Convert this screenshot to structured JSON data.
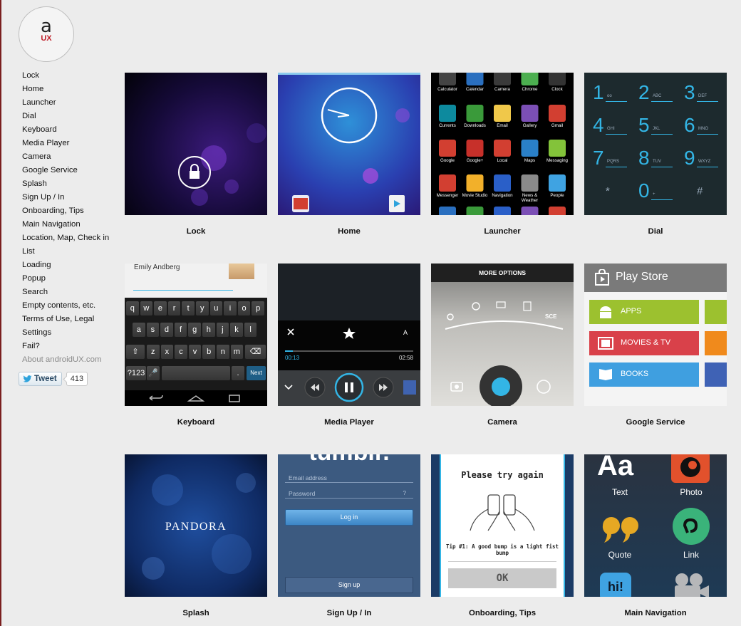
{
  "logo": {
    "letter": "a",
    "sub": "UX"
  },
  "nav": [
    "Lock",
    "Home",
    "Launcher",
    "Dial",
    "Keyboard",
    "Media Player",
    "Camera",
    "Google Service",
    "Splash",
    "Sign Up / In",
    "Onboarding, Tips",
    "Main Navigation",
    "Location, Map, Check in",
    "List",
    "Loading",
    "Popup",
    "Search",
    "Empty contents, etc.",
    "Terms of Use, Legal",
    "Settings",
    "Fail?"
  ],
  "about": "About androidUX.com",
  "tweet": {
    "label": "Tweet",
    "count": "413"
  },
  "tiles": [
    "Lock",
    "Home",
    "Launcher",
    "Dial",
    "Keyboard",
    "Media Player",
    "Camera",
    "Google Service",
    "Splash",
    "Sign Up / In",
    "Onboarding, Tips",
    "Main Navigation"
  ],
  "launcher": {
    "row1": [
      "Calculator",
      "Calendar",
      "Camera",
      "Chrome",
      "Clock"
    ],
    "row2": [
      "Currents",
      "Downloads",
      "Email",
      "Gallery",
      "Gmail"
    ],
    "row3": [
      "Google",
      "Google+",
      "Local",
      "Maps",
      "Messaging"
    ],
    "row4": [
      "Messenger",
      "Movie Studio",
      "Navigation",
      "News & Weather",
      "People"
    ]
  },
  "dial": {
    "keys": [
      {
        "n": "1",
        "l": "ᴏᴏ"
      },
      {
        "n": "2",
        "l": "ABC"
      },
      {
        "n": "3",
        "l": "DEF"
      },
      {
        "n": "4",
        "l": "GHI"
      },
      {
        "n": "5",
        "l": "JKL"
      },
      {
        "n": "6",
        "l": "MNO"
      },
      {
        "n": "7",
        "l": "PQRS"
      },
      {
        "n": "8",
        "l": "TUV"
      },
      {
        "n": "9",
        "l": "WXYZ"
      },
      {
        "n": "*",
        "l": ""
      },
      {
        "n": "0",
        "l": "+"
      },
      {
        "n": "#",
        "l": ""
      }
    ]
  },
  "keyboard": {
    "contact": "Emily Andberg",
    "row1": [
      "q",
      "w",
      "e",
      "r",
      "t",
      "y",
      "u",
      "i",
      "o",
      "p"
    ],
    "row2": [
      "a",
      "s",
      "d",
      "f",
      "g",
      "h",
      "j",
      "k",
      "l"
    ],
    "row3": [
      "z",
      "x",
      "c",
      "v",
      "b",
      "n",
      "m"
    ],
    "sym": "?123",
    "dot": ".",
    "next": "Next"
  },
  "media": {
    "elapsed": "00:13",
    "total": "02:58",
    "progress": 0.06
  },
  "camera": {
    "menu": "MORE OPTIONS",
    "scene": "SCE"
  },
  "play": {
    "title": "Play Store",
    "apps": "APPS",
    "movies": "MOVIES & TV",
    "books": "BOOKS"
  },
  "splash": {
    "brand": "PANDORA"
  },
  "signup": {
    "brand": "tumblr.",
    "email": "Email address",
    "password": "Password",
    "help": "?",
    "login": "Log in",
    "signup": "Sign up"
  },
  "onboard": {
    "title": "Please try again",
    "tip": "Tip #1: A good bump is a light fist bump",
    "ok": "OK"
  },
  "mainnav": {
    "text": "Text",
    "text_glyph": "Aa",
    "photo": "Photo",
    "quote": "Quote",
    "link": "Link",
    "chat_glyph": "hi!"
  },
  "colors": {
    "accent": "#33b5e5",
    "brand_red": "#c0202a"
  }
}
